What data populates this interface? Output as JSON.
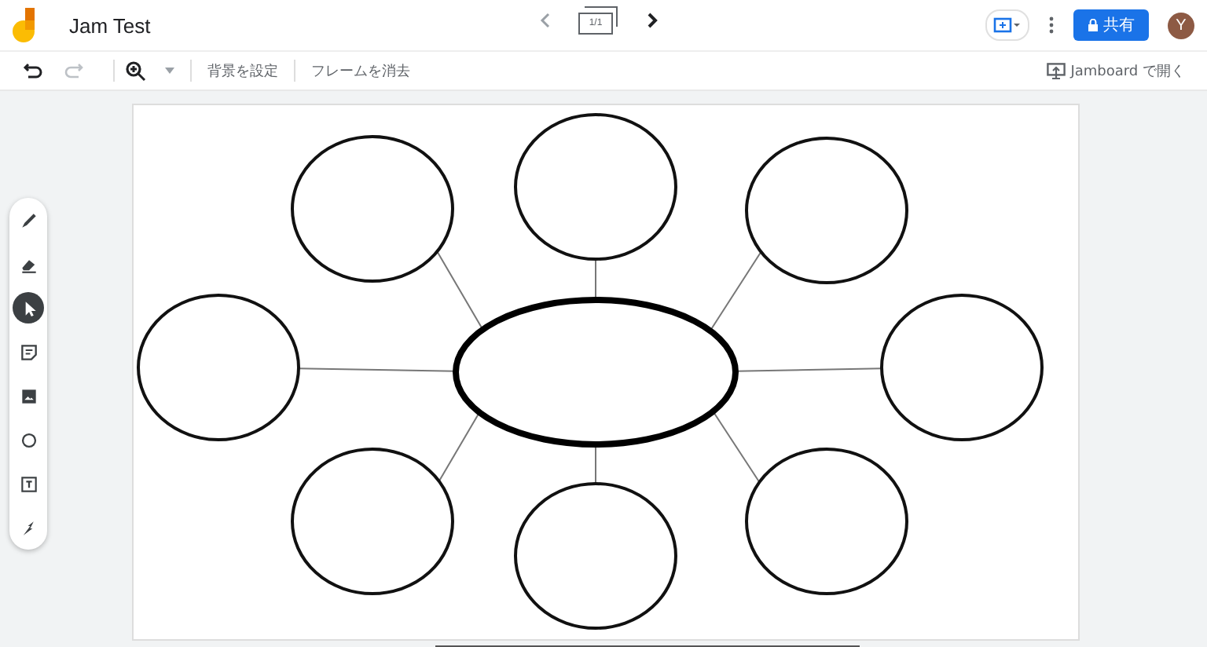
{
  "header": {
    "title": "Jam Test",
    "frame_counter": "1/1",
    "share_button": "共有",
    "avatar": "Y"
  },
  "toolbar": {
    "buttons": [
      "背景を設定",
      "フレームを消去"
    ],
    "open_in": "Jamboard で開く"
  },
  "tools": [
    {
      "kind": "pen",
      "selected": false
    },
    {
      "kind": "eraser",
      "selected": false
    },
    {
      "kind": "select",
      "selected": true
    },
    {
      "kind": "note",
      "selected": false
    },
    {
      "kind": "image",
      "selected": false
    },
    {
      "kind": "shape",
      "selected": false
    },
    {
      "kind": "textbox",
      "selected": false
    },
    {
      "kind": "laser",
      "selected": false
    }
  ]
}
